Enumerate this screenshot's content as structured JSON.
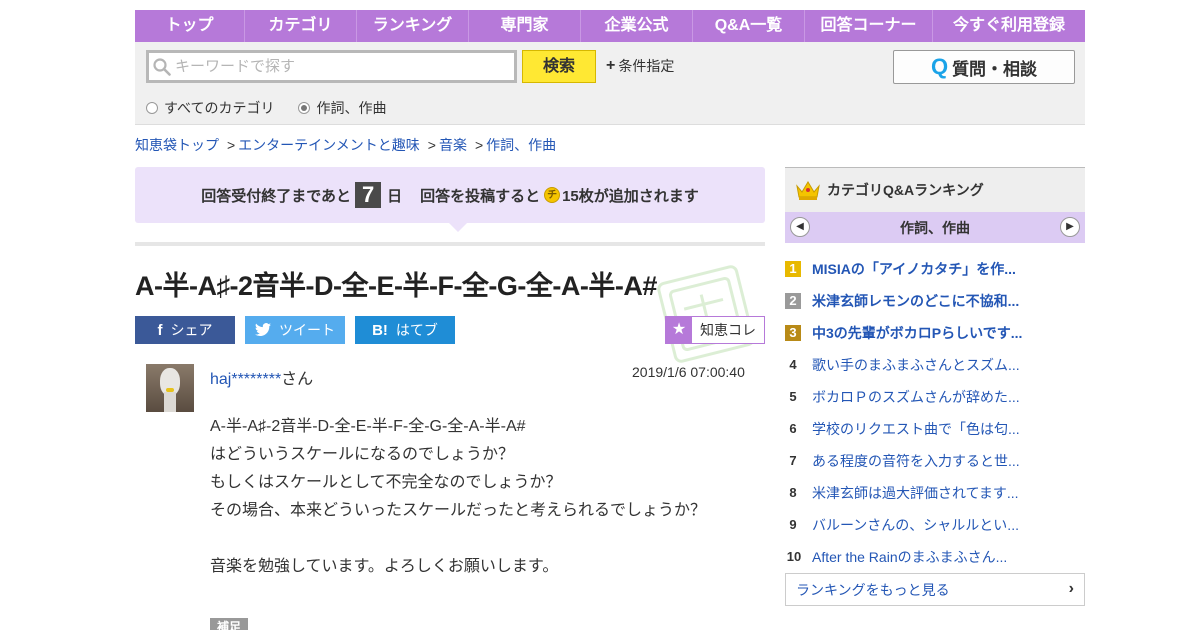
{
  "nav": {
    "items": [
      "トップ",
      "カテゴリ",
      "ランキング",
      "専門家",
      "企業公式",
      "Q&A一覧",
      "回答コーナー",
      "今すぐ利用登録"
    ]
  },
  "search": {
    "placeholder": "キーワードで探す",
    "button_label": "検索",
    "conditions_label": "条件指定",
    "ask_button_label": "質問・相談",
    "ask_button_icon": "Q",
    "radio_all": "すべてのカテゴリ",
    "radio_current": "作詞、作曲",
    "selected_radio": "作詞、作曲"
  },
  "breadcrumb": {
    "items": [
      "知恵袋トップ",
      "エンターテインメントと趣味",
      "音楽",
      "作詞、作曲"
    ],
    "separator": ">"
  },
  "notice": {
    "prefix": "回答受付終了まであと",
    "days": "7",
    "days_unit": "日",
    "middle": "回答を投稿すると",
    "coin_label": "チ",
    "suffix": "15枚が追加されます"
  },
  "question": {
    "title": "A-半-A♯-2音半-D-全-E-半-F-全-G-全-A-半-A#",
    "user": "haj********",
    "user_suffix": "さん",
    "date": "2019/1/6  07:00:40",
    "body": "A-半-A♯-2音半-D-全-E-半-F-全-G-全-A-半-A#\nはどういうスケールになるのでしょうか？\nもしくはスケールとして不完全なのでしょうか？\nその場合、本来どういったスケールだったと考えられるでしょうか？\n\n音楽を勉強しています。よろしくお願いします。",
    "supplement_label": "補足"
  },
  "share": {
    "facebook_icon": "f",
    "facebook": "シェア",
    "twitter_icon": "🐦",
    "twitter": "ツイート",
    "hatena_icon": "B!",
    "hatena": "はてブ",
    "collect_icon": "★",
    "collect": "知恵コレ"
  },
  "sidebar": {
    "title": "カテゴリQ&Aランキング",
    "category": "作詞、作曲",
    "ranking": [
      {
        "rank": "1",
        "title": "MISIAの「アイノカタチ」を作..."
      },
      {
        "rank": "2",
        "title": "米津玄師レモンのどこに不協和..."
      },
      {
        "rank": "3",
        "title": "中3の先輩がボカロPらしいです..."
      },
      {
        "rank": "4",
        "title": "歌い手のまふまふさんとスズム..."
      },
      {
        "rank": "5",
        "title": "ボカロＰのスズムさんが辞めた..."
      },
      {
        "rank": "6",
        "title": "学校のリクエスト曲で「色は匂..."
      },
      {
        "rank": "7",
        "title": "ある程度の音符を入力すると世..."
      },
      {
        "rank": "8",
        "title": "米津玄師は過大評価されてます..."
      },
      {
        "rank": "9",
        "title": "バルーンさんの、シャルルとい..."
      },
      {
        "rank": "10",
        "title": "After the Rainのまふまふさん..."
      }
    ],
    "more_label": "ランキングをもっと見る"
  },
  "colors": {
    "nav_bg": "#b679d9",
    "search_btn": "#ffe833",
    "link": "#2356b5",
    "notice_bg": "#ece2fa",
    "facebook": "#3b5998",
    "twitter": "#55acee",
    "hatena": "#1f8dd6"
  }
}
